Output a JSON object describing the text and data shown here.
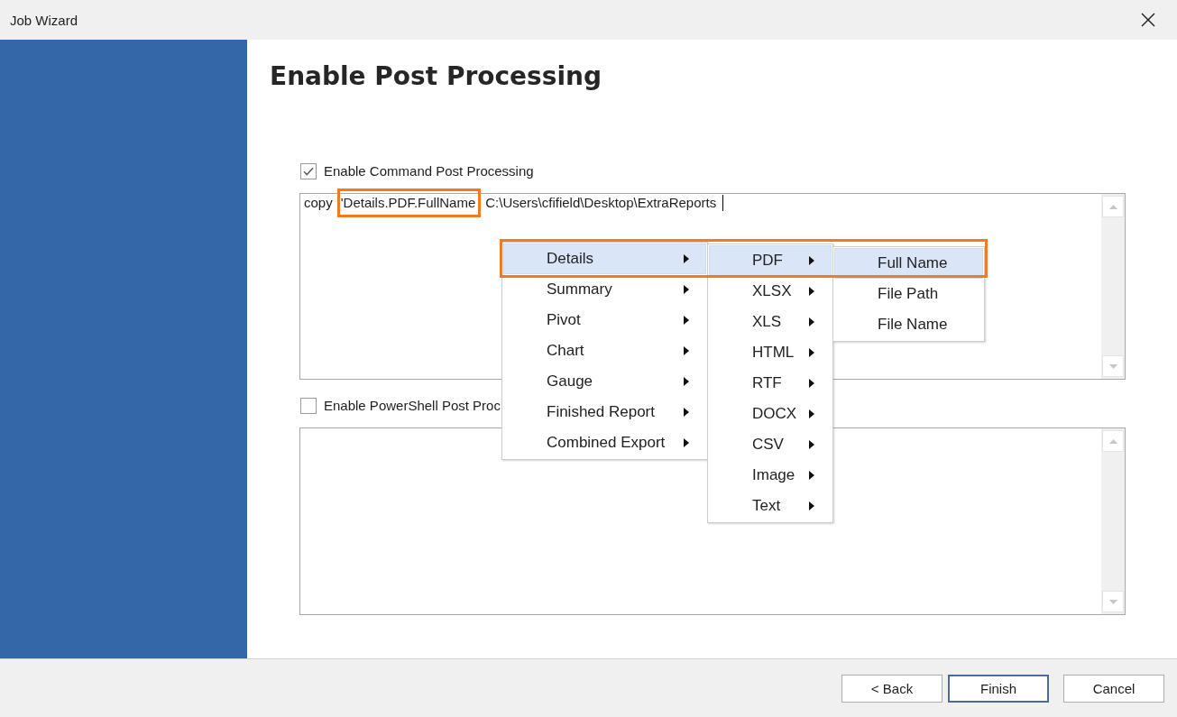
{
  "window": {
    "title": "Job Wizard"
  },
  "page": {
    "heading": "Enable Post Processing"
  },
  "command_post_processing": {
    "label": "Enable Command Post Processing",
    "checked": true,
    "script": {
      "segments": [
        {
          "text": "copy",
          "highlighted": false
        },
        {
          "text": "'Details.PDF.FullName",
          "highlighted": true
        },
        {
          "text": "C:\\Users\\cfifield\\Desktop\\ExtraReports",
          "highlighted": false
        }
      ]
    }
  },
  "powershell_post_processing": {
    "label": "Enable PowerShell Post Proc",
    "checked": false
  },
  "context_menu": {
    "outlined": true,
    "levels": [
      {
        "items": [
          {
            "label": "Details",
            "selected": true,
            "submenu": true
          },
          {
            "label": "Summary",
            "selected": false,
            "submenu": true
          },
          {
            "label": "Pivot",
            "selected": false,
            "submenu": true
          },
          {
            "label": "Chart",
            "selected": false,
            "submenu": true
          },
          {
            "label": "Gauge",
            "selected": false,
            "submenu": true
          },
          {
            "label": "Finished Report",
            "selected": false,
            "submenu": true
          },
          {
            "label": "Combined Export",
            "selected": false,
            "submenu": true
          }
        ]
      },
      {
        "items": [
          {
            "label": "PDF",
            "selected": true,
            "submenu": true
          },
          {
            "label": "XLSX",
            "selected": false,
            "submenu": true
          },
          {
            "label": "XLS",
            "selected": false,
            "submenu": true
          },
          {
            "label": "HTML",
            "selected": false,
            "submenu": true
          },
          {
            "label": "RTF",
            "selected": false,
            "submenu": true
          },
          {
            "label": "DOCX",
            "selected": false,
            "submenu": true
          },
          {
            "label": "CSV",
            "selected": false,
            "submenu": true
          },
          {
            "label": "Image",
            "selected": false,
            "submenu": true
          },
          {
            "label": "Text",
            "selected": false,
            "submenu": true
          }
        ]
      },
      {
        "items": [
          {
            "label": "Full Name",
            "selected": true,
            "submenu": false
          },
          {
            "label": "File Path",
            "selected": false,
            "submenu": false
          },
          {
            "label": "File Name",
            "selected": false,
            "submenu": false
          }
        ]
      }
    ]
  },
  "buttons": [
    {
      "label": "< Back",
      "default": false
    },
    {
      "label": "Finish",
      "default": true
    },
    {
      "label": "Cancel",
      "default": false
    }
  ]
}
